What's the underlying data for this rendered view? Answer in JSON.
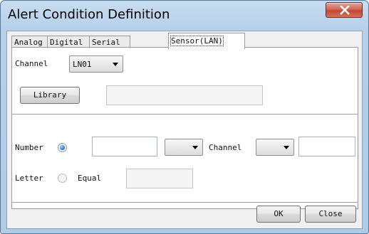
{
  "window": {
    "title": "Alert Condition Definition",
    "close_icon": "close-x-icon"
  },
  "tabs": [
    {
      "label": "Analog",
      "active": false
    },
    {
      "label": "Digital",
      "active": false
    },
    {
      "label": "Serial",
      "active": false
    },
    {
      "label": "Sensor(LAN)",
      "active": true
    }
  ],
  "channel_row": {
    "label": "Channel",
    "selected": "LN01"
  },
  "library_row": {
    "button_label": "Library",
    "field_value": ""
  },
  "number_row": {
    "label": "Number",
    "radio_checked": true,
    "value": "",
    "operator": "",
    "channel_label": "Channel",
    "channel_selected": "",
    "channel_value": ""
  },
  "letter_row": {
    "label": "Letter",
    "radio_checked": false,
    "equal_label": "Equal",
    "equal_value": ""
  },
  "footer": {
    "ok_label": "OK",
    "close_label": "Close"
  },
  "colors": {
    "titlebar": "#b6d0ea",
    "close_button": "#c04733",
    "radio_selected": "#2a7bd6"
  }
}
